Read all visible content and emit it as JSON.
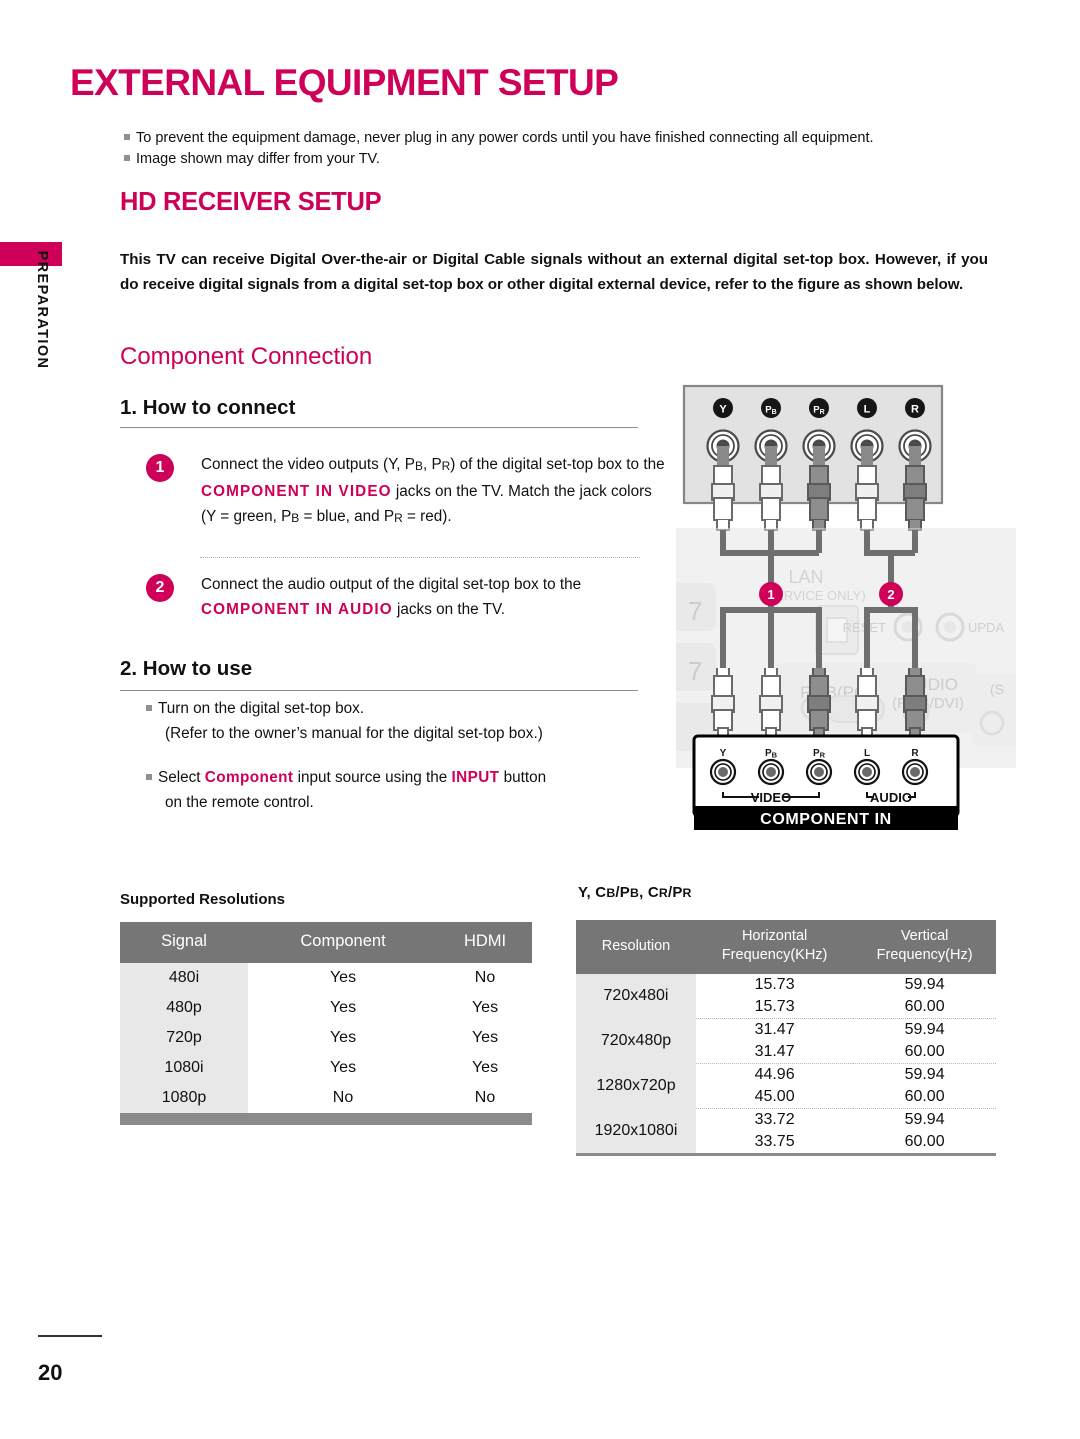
{
  "side_tab": {
    "label": "PREPARATION",
    "accent": "#CE0058"
  },
  "headings": {
    "h1": "EXTERNAL EQUIPMENT SETUP",
    "h2": "HD RECEIVER SETUP",
    "h3": "Component Connection",
    "step1_heading": "1. How to connect",
    "step2_heading": "2. How to use"
  },
  "notes": [
    "To prevent the equipment damage, never plug in any power cords until you have finished connecting all equipment.",
    "Image shown may differ from your TV."
  ],
  "intro": "This TV can receive Digital Over-the-air or Digital Cable signals without an external digital set-top box. However, if you do receive digital signals from a digital set-top box or other digital external device, refer to the figure as shown below.",
  "steps": [
    {
      "number": "1",
      "pre": "Connect the video outputs (Y, P",
      "sub_b": "B",
      "mid1": ", P",
      "sub_r": "R",
      "mid2": ") of the digital set-top box to the ",
      "keyword": "COMPONENT IN VIDEO",
      "post": " jacks on the TV. Match the jack colors (Y = green, P",
      "post_sub_b": "B",
      "post2": " = blue, and P",
      "post_sub_r": "R",
      "post3": " = red)."
    },
    {
      "number": "2",
      "pre": "Connect the audio output of the digital set-top box to the ",
      "keyword": "COMPONENT IN AUDIO",
      "post": " jacks on the TV."
    }
  ],
  "how_to_use": {
    "item1": "Turn on the digital set-top box.",
    "item1_sub": "(Refer to the owner’s manual for the digital set-top box.)",
    "item2_a": "Select ",
    "item2_kw1": "Component",
    "item2_b": " input source using the ",
    "item2_kw2": "INPUT",
    "item2_c": " button",
    "item2_line2": "on the remote control."
  },
  "left_table": {
    "caption": "Supported Resolutions",
    "columns": [
      "Signal",
      "Component",
      "HDMI"
    ],
    "rows": [
      [
        "480i",
        "Yes",
        "No"
      ],
      [
        "480p",
        "Yes",
        "Yes"
      ],
      [
        "720p",
        "Yes",
        "Yes"
      ],
      [
        "1080i",
        "Yes",
        "Yes"
      ],
      [
        "1080p",
        "No",
        "No"
      ]
    ]
  },
  "right_table": {
    "caption_a": "Y, C",
    "caption_b": "B",
    "caption_c": "/P",
    "caption_d": "B",
    "caption_e": ", C",
    "caption_f": "R",
    "caption_g": "/P",
    "caption_h": "R",
    "caption_plain": "Y, CB/PB, CR/PR",
    "columns": [
      "Resolution",
      "Horizontal",
      "Frequency(KHz)",
      "Vertical",
      "Frequency(Hz)"
    ],
    "rows": [
      {
        "resolution": "720x480i",
        "h": [
          "15.73",
          "15.73"
        ],
        "v": [
          "59.94",
          "60.00"
        ]
      },
      {
        "resolution": "720x480p",
        "h": [
          "31.47",
          "31.47"
        ],
        "v": [
          "59.94",
          "60.00"
        ]
      },
      {
        "resolution": "1280x720p",
        "h": [
          "44.96",
          "45.00"
        ],
        "v": [
          "59.94",
          "60.00"
        ]
      },
      {
        "resolution": "1920x1080i",
        "h": [
          "33.72",
          "33.75"
        ],
        "v": [
          "59.94",
          "60.00"
        ]
      }
    ]
  },
  "diagram": {
    "top_jack_labels": [
      "Y",
      "PB",
      "PR",
      "L",
      "R"
    ],
    "callouts": [
      "1",
      "2"
    ],
    "panel_labels": {
      "lan": "LAN",
      "lan_sub": "(SERVICE ONLY)",
      "reset": "RESET",
      "update": "UPDA",
      "rgb": "RGB(PC)",
      "audio": "AUDIO",
      "audio_sub": "(RGB/DVI)",
      "side": "(S"
    },
    "component_in": {
      "jacks": [
        "Y",
        "PB",
        "PR",
        "L",
        "R"
      ],
      "video_label": "VIDEO",
      "audio_label": "AUDIO",
      "title": "COMPONENT IN"
    }
  },
  "footer": {
    "page_number": "20"
  }
}
